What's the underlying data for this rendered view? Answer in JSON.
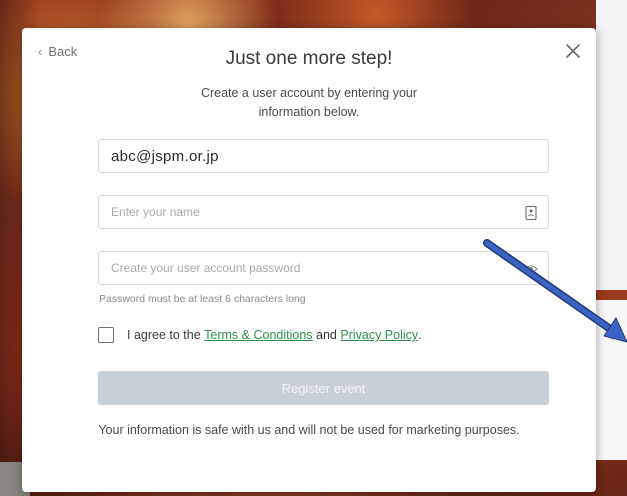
{
  "modal": {
    "back_label": "Back",
    "title": "Just one more step!",
    "subtitle": "Create a user account by entering your information below.",
    "email": {
      "value": "abc@jspm.or.jp"
    },
    "name": {
      "placeholder": "Enter your name",
      "icon": "contact-card-icon"
    },
    "password": {
      "placeholder": "Create your user account password",
      "icon": "eye-icon"
    },
    "password_hint": "Password must be at least 6 characters long",
    "agree": {
      "prefix": "I agree to the",
      "terms_link": "Terms & Conditions",
      "and": "and",
      "privacy_link": "Privacy Policy",
      "suffix": "."
    },
    "register_label": "Register event",
    "safe_note": "Your information is safe with us and will not be used for marketing purposes.",
    "close_icon": "close-icon"
  },
  "colors": {
    "link_green": "#2e8f4c",
    "button_disabled": "#c8cfd6",
    "annotation_arrow": "#2f56b0"
  }
}
